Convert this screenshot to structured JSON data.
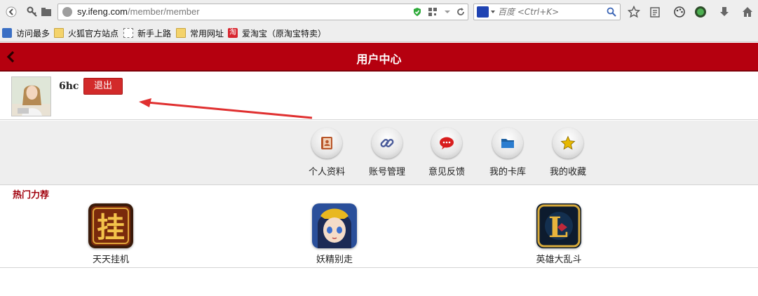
{
  "browser": {
    "url_host": "sy.ifeng.com",
    "url_path": "/member/member",
    "search_placeholder": "百度 <Ctrl+K>",
    "bookmarks": [
      {
        "label": "访问最多",
        "icon": "most-visited-icon"
      },
      {
        "label": "火狐官方站点",
        "icon": "folder-icon"
      },
      {
        "label": "新手上路",
        "icon": "page-icon"
      },
      {
        "label": "常用网址",
        "icon": "folder-icon"
      },
      {
        "label": "爱淘宝（原淘宝特卖）",
        "icon": "taobao-icon",
        "icon_text": "淘"
      }
    ]
  },
  "header": {
    "title": "用户中心",
    "back_icon": "chevron-left-icon",
    "color": "#b5000f"
  },
  "profile": {
    "username": "6hc",
    "logout_label": "退出"
  },
  "menu": {
    "items": [
      {
        "label": "个人资料",
        "icon": "contacts-book-icon"
      },
      {
        "label": "账号管理",
        "icon": "link-icon"
      },
      {
        "label": "意见反馈",
        "icon": "chat-bubble-icon"
      },
      {
        "label": "我的卡库",
        "icon": "folder-icon"
      },
      {
        "label": "我的收藏",
        "icon": "star-icon"
      }
    ]
  },
  "hot": {
    "title": "热门力荐",
    "games": [
      {
        "label": "天天挂机",
        "icon": "guaji-game-icon",
        "icon_text": "挂"
      },
      {
        "label": "妖精别走",
        "icon": "fairy-game-icon"
      },
      {
        "label": "英雄大乱斗",
        "icon": "heroes-game-icon",
        "icon_text": "L"
      }
    ]
  }
}
